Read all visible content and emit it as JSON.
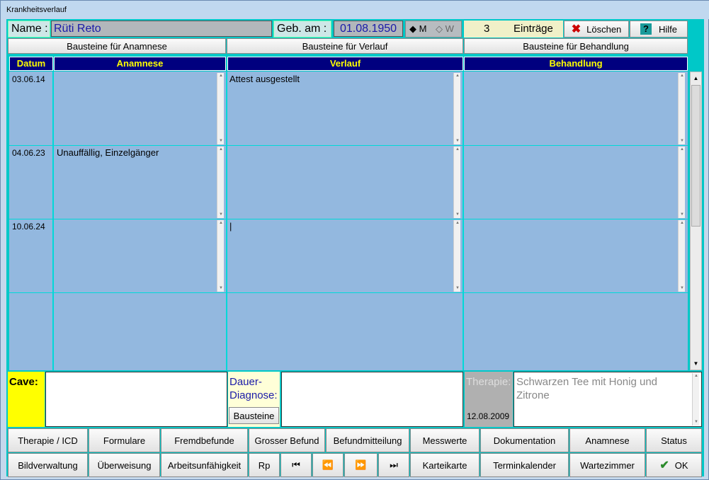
{
  "window": {
    "title": "Krankheitsverlauf"
  },
  "header": {
    "name_label": "Name :",
    "name_value": "Rüti Reto",
    "geb_label": "Geb. am :",
    "geb_value": "01.08.1950",
    "gender_m": "M",
    "gender_w": "W",
    "gender_selected": "M",
    "count": "3",
    "entries_label": "Einträge",
    "delete_label": "Löschen",
    "help_label": "Hilfe"
  },
  "bausteine": {
    "anamnese": "Bausteine für Anamnese",
    "verlauf": "Bausteine für Verlauf",
    "behandlung": "Bausteine für Behandlung"
  },
  "table": {
    "headers": [
      "Datum",
      "Anamnese",
      "Verlauf",
      "Behandlung"
    ],
    "rows": [
      {
        "date": "03.06.14",
        "anamnese": "",
        "verlauf": "Attest ausgestellt",
        "behandlung": ""
      },
      {
        "date": "04.06.23",
        "anamnese": "Unauffällig, Einzelgänger",
        "verlauf": "",
        "behandlung": ""
      },
      {
        "date": "10.06.24",
        "anamnese": "",
        "verlauf": "|",
        "behandlung": ""
      }
    ]
  },
  "bottom": {
    "cave_label": "Cave:",
    "dauer_label_1": "Dauer-",
    "dauer_label_2": "Diagnose:",
    "bausteine_button": "Bausteine",
    "therapie_label": "Therapie:",
    "therapie_date": "12.08.2009",
    "therapie_text": "Schwarzen Tee mit Honig und Zitrone"
  },
  "buttons": {
    "row1": [
      "Therapie / ICD",
      "Formulare",
      "Fremdbefunde",
      "Grosser Befund",
      "Befundmitteilung",
      "Messwerte",
      "Dokumentation",
      "Anamnese",
      "Status"
    ],
    "row2": [
      "Bildverwaltung",
      "Überweisung",
      "Arbeitsunfähigkeit",
      "Rp",
      "",
      "",
      "",
      "",
      "Karteikarte",
      "Terminkalender",
      "Wartezimmer",
      "OK"
    ]
  },
  "colors": {
    "header_bg": "#00007f",
    "header_text": "#ffff00",
    "cell_bg": "#93b8df",
    "grid": "#00d8d8",
    "cave_bg": "#ffff00"
  },
  "icons": [
    "delete-icon",
    "help-icon",
    "first-icon",
    "prev-icon",
    "next-icon",
    "last-icon",
    "ok-check-icon"
  ]
}
